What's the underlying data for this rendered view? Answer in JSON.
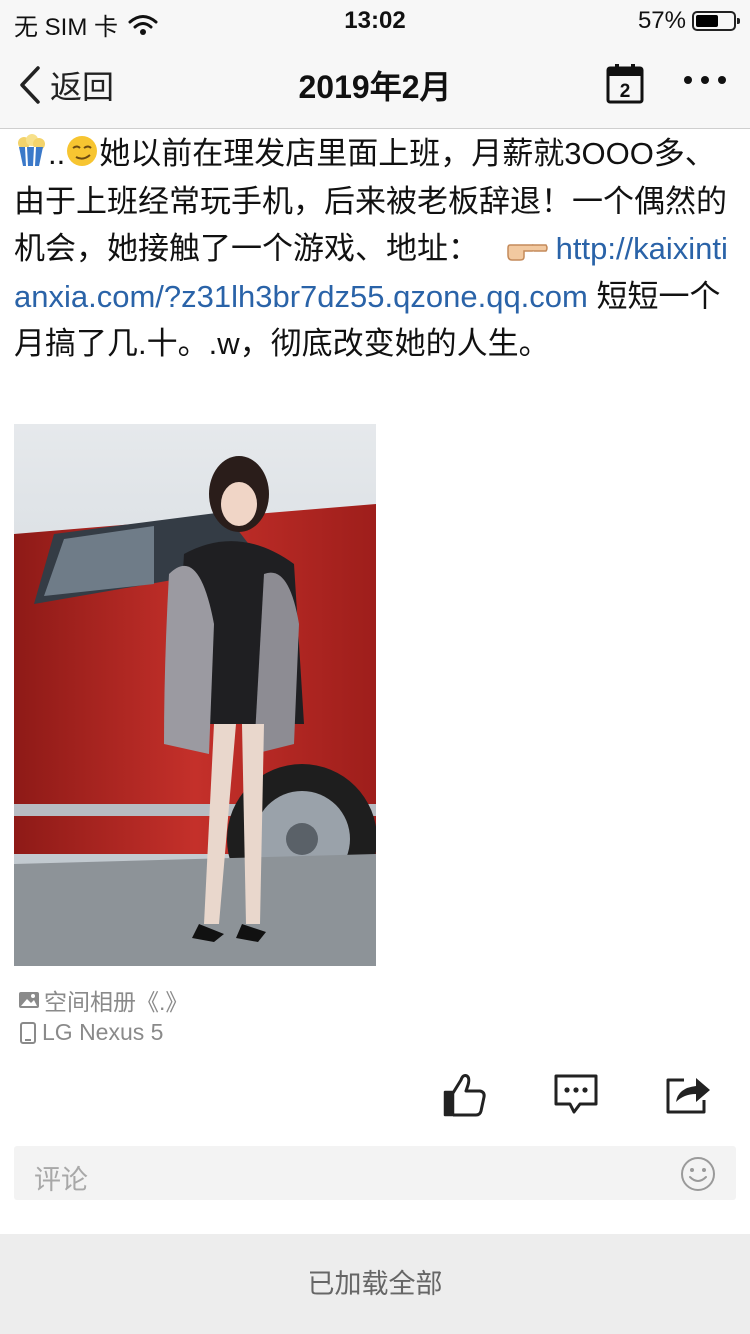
{
  "status_bar": {
    "carrier": "无 SIM 卡",
    "time": "13:02",
    "battery": "57%"
  },
  "nav": {
    "back_label": "返回",
    "title": "2019年2月",
    "calendar_day": "2"
  },
  "post": {
    "emoji_prefix": "..",
    "text_before_link": "她以前在理发店里面上班，月薪就3OOO多、由于上班经常玩手机，后来被老板辞退！一个偶然的机会，她接触了一个游戏、地址：",
    "link": "http://kaixintianxia.com/?z31lh3br7dz55.qzone.qq.com",
    "text_after_link": " 短短一个月搞了几.十。.w，彻底改变她的人生。"
  },
  "meta": {
    "album": "空间相册《.》",
    "device": "LG Nexus 5"
  },
  "comment": {
    "placeholder": "评论"
  },
  "footer": {
    "label": "已加载全部"
  },
  "icons": {
    "back": "chevron-left-icon",
    "calendar": "calendar-icon",
    "more": "more-dots-icon",
    "like": "thumbs-up-icon",
    "comment": "comment-bubble-icon",
    "share": "share-icon",
    "album": "image-icon",
    "device": "phone-icon",
    "emoji": "smile-icon"
  }
}
